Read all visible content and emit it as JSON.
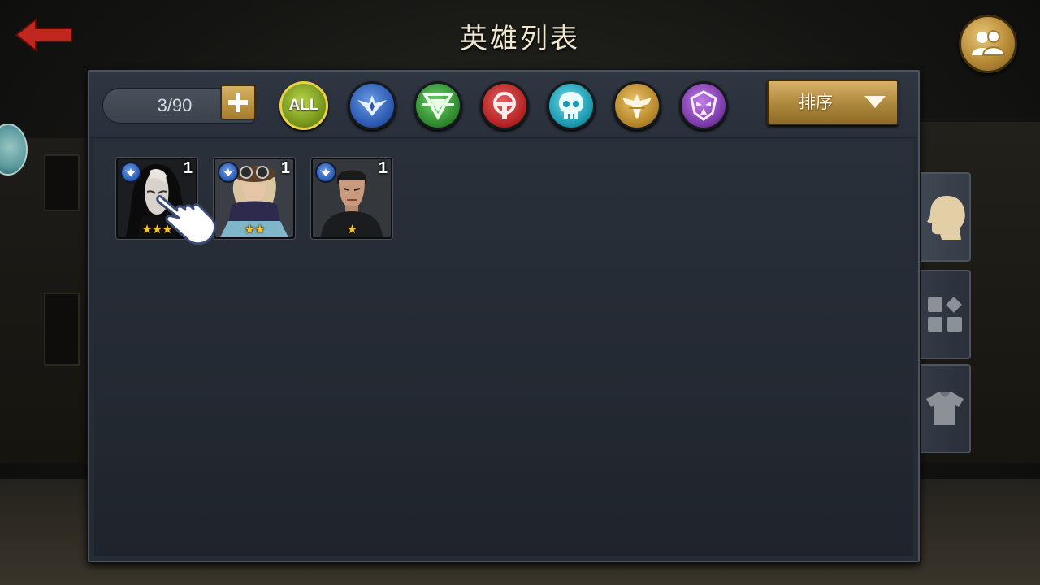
{
  "header": {
    "title": "英雄列表",
    "back_icon": "back-arrow-icon",
    "friends_icon": "friends-icon"
  },
  "toolbar": {
    "hero_count": "3/90",
    "add_icon": "plus-icon",
    "filters": [
      {
        "label": "ALL",
        "color": "#7b9a1e",
        "icon": "all-filter"
      },
      {
        "icon": "blue-wings-faction-icon",
        "color": "#2b59b0"
      },
      {
        "icon": "green-v-faction-icon",
        "color": "#2f8a2e"
      },
      {
        "icon": "red-emblem-faction-icon",
        "color": "#b52424"
      },
      {
        "icon": "cyan-skull-faction-icon",
        "color": "#1c9bb0"
      },
      {
        "icon": "gold-eagle-faction-icon",
        "color": "#b5862a"
      },
      {
        "icon": "purple-mask-faction-icon",
        "color": "#7b3aa8"
      }
    ],
    "sort_label": "排序"
  },
  "heroes": [
    {
      "level": "1",
      "stars": 3,
      "stars_text": "★★★",
      "faction": "blue-wings-faction-icon",
      "portrait": "hooded-woman-portrait"
    },
    {
      "level": "1",
      "stars": 2,
      "stars_text": "★★",
      "faction": "blue-wings-faction-icon",
      "portrait": "goggles-scarf-woman-portrait"
    },
    {
      "level": "1",
      "stars": 1,
      "stars_text": "★",
      "faction": "blue-wings-faction-icon",
      "portrait": "short-hair-man-portrait"
    }
  ],
  "side_tabs": [
    {
      "icon": "head-profile-icon",
      "active": true
    },
    {
      "icon": "grid-shapes-icon",
      "active": false
    },
    {
      "icon": "shirt-icon",
      "active": false
    }
  ],
  "pointer": "tap-hand-icon",
  "colors": {
    "panel_bg": "#262c36",
    "gold_accent": "#b08a3f",
    "star": "#f4c52e"
  }
}
